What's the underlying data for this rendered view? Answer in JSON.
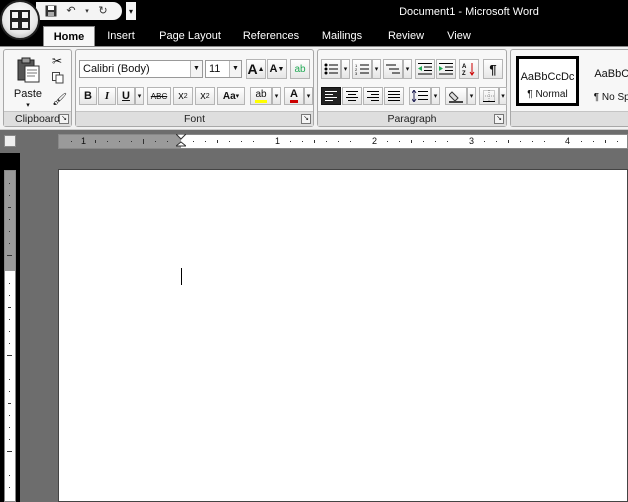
{
  "window": {
    "title": "Document1 - Microsoft Word"
  },
  "tabs": [
    "Home",
    "Insert",
    "Page Layout",
    "References",
    "Mailings",
    "Review",
    "View"
  ],
  "active_tab": "Home",
  "clipboard": {
    "paste_label": "Paste",
    "group_label": "Clipboard"
  },
  "font": {
    "name": "Calibri (Body)",
    "size": "11",
    "group_label": "Font",
    "bold": "B",
    "italic": "I",
    "underline": "U",
    "strike": "ABC",
    "subscript_base": "x",
    "subscript_mark": "2",
    "superscript_base": "x",
    "superscript_mark": "2",
    "change_case": "Aa",
    "grow": "A",
    "shrink": "A",
    "font_color_glyph": "A"
  },
  "paragraph": {
    "group_label": "Paragraph",
    "pilcrow": "¶"
  },
  "styles": [
    {
      "sample": "AaBbCcDc",
      "name": "¶ Normal"
    },
    {
      "sample": "AaBbCc",
      "name": "¶ No Spa"
    }
  ],
  "ruler": {
    "numbers": [
      "1",
      "1",
      "2",
      "3",
      "4"
    ]
  },
  "colors": {
    "title_bar": "#000000",
    "ribbon": "#f2f2f2",
    "workspace": "#6d6d6d",
    "page": "#ffffff"
  }
}
